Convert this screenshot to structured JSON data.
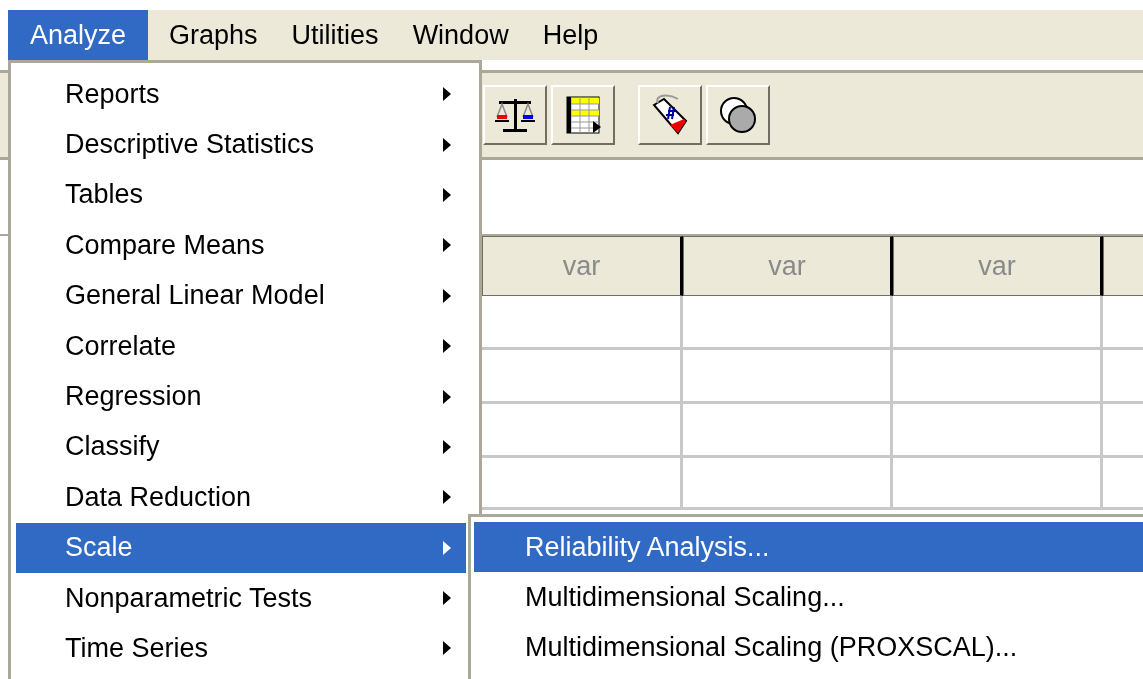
{
  "menubar": [
    {
      "label": "Analyze",
      "selected": true
    },
    {
      "label": "Graphs",
      "selected": false
    },
    {
      "label": "Utilities",
      "selected": false
    },
    {
      "label": "Window",
      "selected": false
    },
    {
      "label": "Help",
      "selected": false
    }
  ],
  "toolbar": [
    {
      "kind": "scale"
    },
    {
      "kind": "table"
    },
    {
      "kind": "tag"
    },
    {
      "kind": "circles"
    }
  ],
  "grid": {
    "columns": [
      "var",
      "var",
      "var"
    ]
  },
  "analyze_menu": [
    {
      "label": "Reports",
      "selected": false
    },
    {
      "label": "Descriptive Statistics",
      "selected": false
    },
    {
      "label": "Tables",
      "selected": false
    },
    {
      "label": "Compare Means",
      "selected": false
    },
    {
      "label": "General Linear Model",
      "selected": false
    },
    {
      "label": "Correlate",
      "selected": false
    },
    {
      "label": "Regression",
      "selected": false
    },
    {
      "label": "Classify",
      "selected": false
    },
    {
      "label": "Data Reduction",
      "selected": false
    },
    {
      "label": "Scale",
      "selected": true
    },
    {
      "label": "Nonparametric Tests",
      "selected": false
    },
    {
      "label": "Time Series",
      "selected": false
    }
  ],
  "scale_submenu": [
    {
      "label": "Reliability Analysis...",
      "selected": true
    },
    {
      "label": "Multidimensional Scaling...",
      "selected": false
    },
    {
      "label": "Multidimensional Scaling (PROXSCAL)...",
      "selected": false
    }
  ]
}
